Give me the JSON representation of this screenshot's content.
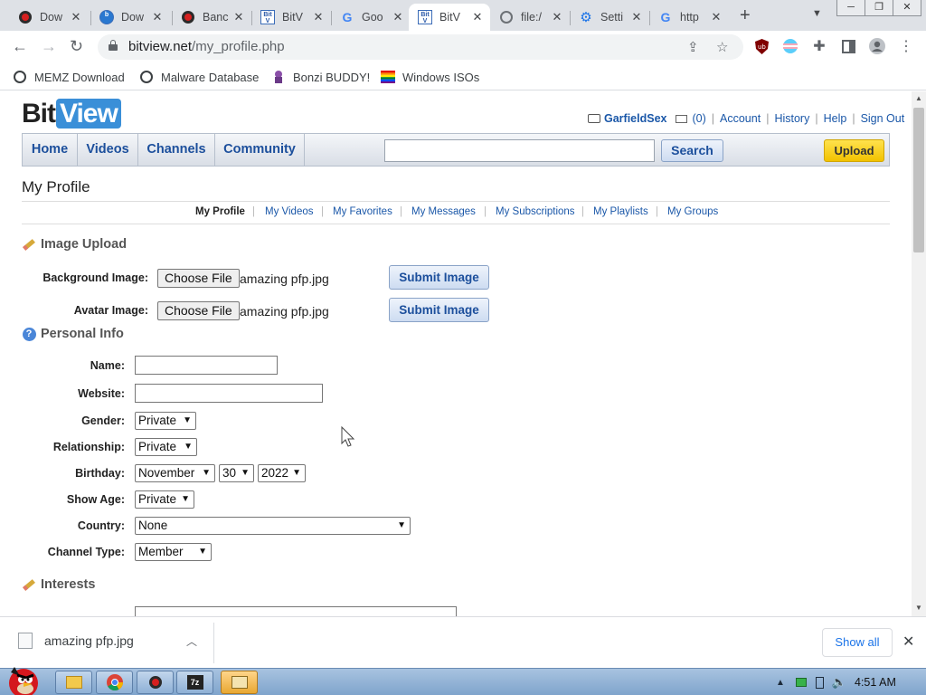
{
  "browser": {
    "tabs": [
      {
        "title": "Dow",
        "icon": "red-dot-icon"
      },
      {
        "title": "Dow",
        "icon": "bitview-icon"
      },
      {
        "title": "Banc",
        "icon": "red-dot-icon"
      },
      {
        "title": "BitV",
        "icon": "bitview-icon"
      },
      {
        "title": "Goo",
        "icon": "google-icon"
      },
      {
        "title": "BitV",
        "icon": "bitview-icon"
      },
      {
        "title": "file:/",
        "icon": "globe-icon"
      },
      {
        "title": "Setti",
        "icon": "gear-icon"
      },
      {
        "title": "http",
        "icon": "google-icon"
      }
    ],
    "active_tab": 5,
    "url_host": "bitview.net",
    "url_path": "/my_profile.php",
    "bookmarks": [
      {
        "label": "MEMZ Download",
        "icon": "globe-icon"
      },
      {
        "label": "Malware Database",
        "icon": "globe-icon"
      },
      {
        "label": "Bonzi BUDDY!",
        "icon": "bonzi-icon"
      },
      {
        "label": "Windows ISOs",
        "icon": "rainbow-flag-icon"
      }
    ]
  },
  "site": {
    "logo_bit": "Bit",
    "logo_view": "View",
    "user": {
      "username": "GarfieldSex",
      "messages_count": "(0)",
      "links": [
        "Account",
        "History",
        "Help",
        "Sign Out"
      ]
    },
    "nav": [
      "Home",
      "Videos",
      "Channels",
      "Community"
    ],
    "search_button": "Search",
    "upload_button": "Upload",
    "page_title": "My Profile",
    "subnav": [
      "My Profile",
      "My Videos",
      "My Favorites",
      "My Messages",
      "My Subscriptions",
      "My Playlists",
      "My Groups"
    ],
    "image_upload": {
      "heading": "Image Upload",
      "background_label": "Background Image:",
      "avatar_label": "Avatar Image:",
      "choose_file": "Choose File",
      "background_file": "amazing pfp.jpg",
      "avatar_file": "amazing pfp.jpg",
      "submit": "Submit Image"
    },
    "personal_info": {
      "heading": "Personal Info",
      "name_label": "Name:",
      "name_value": "",
      "website_label": "Website:",
      "website_value": "",
      "gender_label": "Gender:",
      "gender_value": "Private",
      "relationship_label": "Relationship:",
      "relationship_value": "Private",
      "birthday_label": "Birthday:",
      "birthday_month": "November",
      "birthday_day": "30",
      "birthday_year": "2022",
      "show_age_label": "Show Age:",
      "show_age_value": "Private",
      "country_label": "Country:",
      "country_value": "None",
      "channel_type_label": "Channel Type:",
      "channel_type_value": "Member"
    },
    "interests": {
      "heading": "Interests"
    }
  },
  "download_bar": {
    "filename": "amazing pfp.jpg",
    "show_all": "Show all"
  },
  "taskbar": {
    "clock": "4:51 AM"
  }
}
